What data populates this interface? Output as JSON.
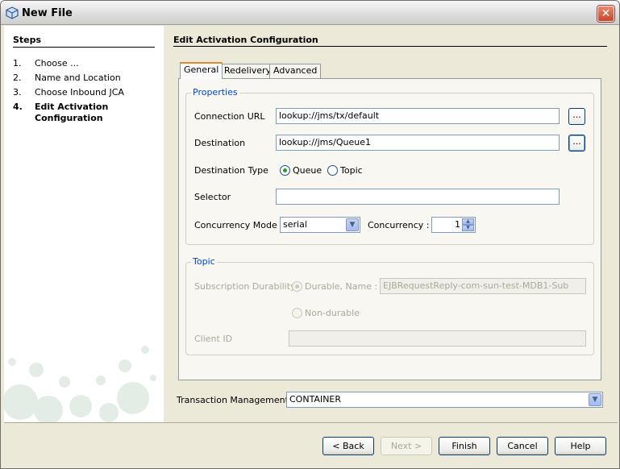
{
  "window": {
    "title": "New File",
    "close_glyph": "✕"
  },
  "steps": {
    "title": "Steps",
    "items": [
      {
        "num": "1.",
        "label": "Choose ..."
      },
      {
        "num": "2.",
        "label": "Name and Location"
      },
      {
        "num": "3.",
        "label": "Choose Inbound JCA"
      },
      {
        "num": "4.",
        "label": "Edit Activation",
        "label2": "Configuration"
      }
    ]
  },
  "page": {
    "title": "Edit Activation Configuration"
  },
  "tabs": [
    "General",
    "Redelivery",
    "Advanced"
  ],
  "properties": {
    "title": "Properties",
    "connection_url_label": "Connection URL",
    "connection_url_value": "lookup://jms/tx/default",
    "destination_label": "Destination",
    "destination_value": "lookup://jms/Queue1",
    "browse_label": "...",
    "destination_type_label": "Destination Type",
    "queue_label": "Queue",
    "topic_label": "Topic",
    "selector_label": "Selector",
    "selector_value": "",
    "concurrency_mode_label": "Concurrency Mode",
    "concurrency_mode_value": "serial",
    "concurrency_label": "Concurrency :",
    "concurrency_value": "1"
  },
  "topic": {
    "title": "Topic",
    "subscription_label": "Subscription Durability",
    "durable_label": "Durable, Name :",
    "durable_name_value": "EJBRequestReply-com-sun-test-MDB1-Sub",
    "nondurable_label": "Non-durable",
    "client_id_label": "Client ID",
    "client_id_value": ""
  },
  "transaction": {
    "label": "Transaction Management:",
    "value": "CONTAINER"
  },
  "buttons": {
    "back": "< Back",
    "next": "Next >",
    "finish": "Finish",
    "cancel": "Cancel",
    "help": "Help"
  },
  "colors": {
    "group_title": "#0046d5",
    "tab_accent": "#e68b2c"
  }
}
